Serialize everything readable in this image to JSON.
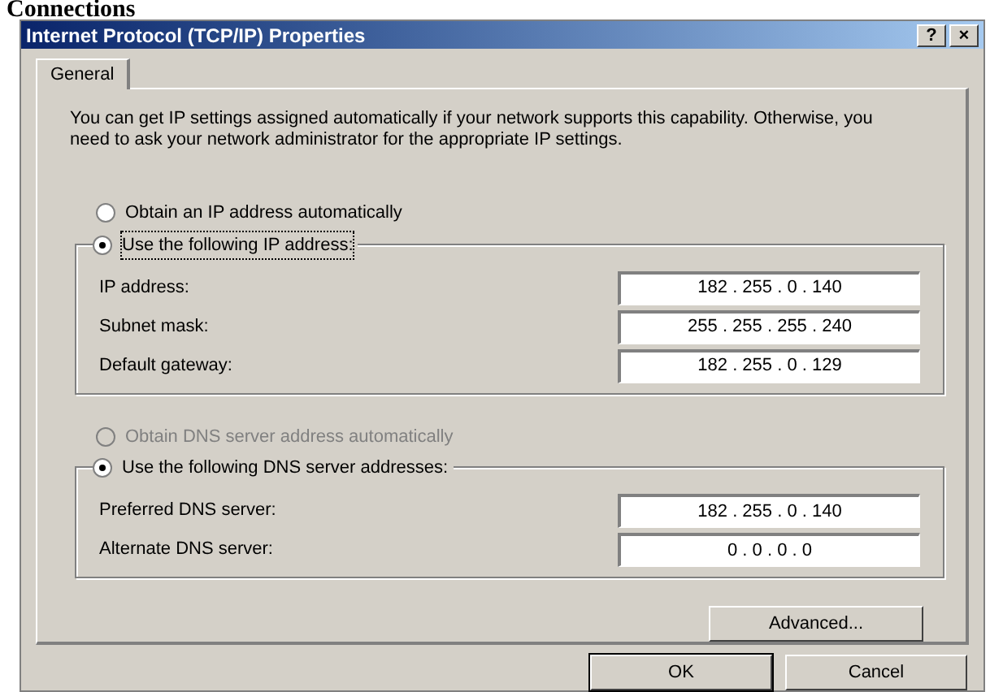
{
  "page_heading": "Connections",
  "window": {
    "title": "Internet Protocol (TCP/IP) Properties",
    "title_buttons": [
      "?",
      "×"
    ]
  },
  "tabs": [
    {
      "label": "General",
      "selected": true
    }
  ],
  "description": "You can get IP settings assigned automatically if your network supports this capability. Otherwise, you need to ask your network administrator for the appropriate IP settings.",
  "ip_options": [
    {
      "label": "Obtain an IP address automatically",
      "selected": false,
      "disabled": false
    },
    {
      "label": "Use the following IP address:",
      "selected": true,
      "disabled": false,
      "focused": true
    }
  ],
  "ip_fields": [
    {
      "label": "IP address:",
      "value": "182 . 255 . 0 . 140"
    },
    {
      "label": "Subnet mask:",
      "value": "255 . 255 . 255 . 240"
    },
    {
      "label": "Default gateway:",
      "value": "182 . 255 . 0 . 129"
    }
  ],
  "dns_options": [
    {
      "label": "Obtain DNS server address automatically",
      "selected": false,
      "disabled": true
    },
    {
      "label": "Use the following DNS server addresses:",
      "selected": true,
      "disabled": false,
      "focused": false
    }
  ],
  "dns_fields": [
    {
      "label": "Preferred DNS server:",
      "value": "182 . 255 . 0 . 140"
    },
    {
      "label": "Alternate DNS server:",
      "value": "0 . 0 . 0 . 0"
    }
  ],
  "advanced_button": "Advanced...",
  "buttons": [
    {
      "label": "OK",
      "default": true
    },
    {
      "label": "Cancel",
      "default": false
    }
  ]
}
